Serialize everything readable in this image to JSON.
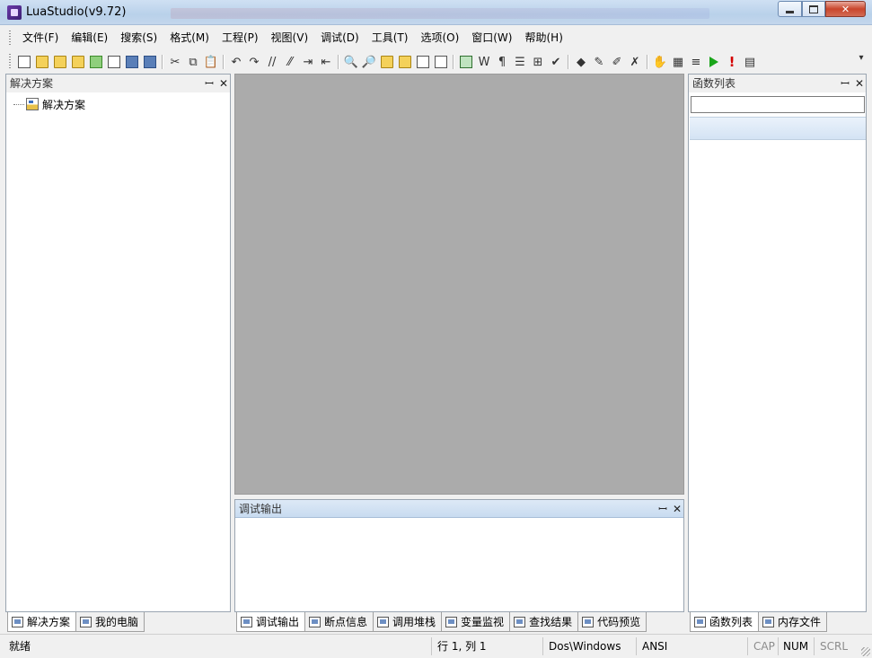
{
  "window": {
    "title": "LuaStudio(v9.72)",
    "controls": {
      "minimize": "minimize",
      "maximize": "maximize",
      "close": "✕"
    }
  },
  "menu": [
    "文件(F)",
    "编辑(E)",
    "搜索(S)",
    "格式(M)",
    "工程(P)",
    "视图(V)",
    "调试(D)",
    "工具(T)",
    "选项(O)",
    "窗口(W)",
    "帮助(H)"
  ],
  "toolbar": {
    "icons": [
      "new-file-icon",
      "new-project-icon",
      "open-folder-icon",
      "open-project-icon",
      "properties-icon",
      "tree-icon",
      "save-icon",
      "save-all-icon",
      "cut-icon",
      "copy-icon",
      "paste-icon",
      "undo-icon",
      "redo-icon",
      "comment-icon",
      "uncomment-icon",
      "indent-icon",
      "outdent-icon",
      "find-icon",
      "find-next-icon",
      "find-in-files-icon",
      "replace-icon",
      "bookmark-prev-icon",
      "bookmark-next-icon",
      "fullscreen-icon",
      "word-wrap-icon",
      "pilcrow-icon",
      "format-icon",
      "toggle-icon",
      "check-icon",
      "breakpoint-icon",
      "breakpoint-add-icon",
      "breakpoint-remove-icon",
      "breakpoint-clear-icon",
      "hand-icon",
      "calendar-icon",
      "list-icon",
      "run-icon",
      "stop-icon",
      "panel-icon"
    ],
    "overflow": "▾"
  },
  "left_panel": {
    "title": "解决方案",
    "pin": "ꟷ",
    "close": "✕",
    "tree_root": "解决方案",
    "tabs": [
      "解决方案",
      "我的电脑"
    ]
  },
  "output_panel": {
    "title": "调试输出",
    "tabs": [
      "调试输出",
      "断点信息",
      "调用堆栈",
      "变量监视",
      "查找结果",
      "代码预览"
    ]
  },
  "right_panel": {
    "title": "函数列表",
    "search_value": "",
    "tabs": [
      "函数列表",
      "内存文件"
    ]
  },
  "status": {
    "ready": "就绪",
    "position": "行 1, 列 1",
    "line_ending": "Dos\\Windows",
    "encoding": "ANSI",
    "cap": "CAP",
    "num": "NUM",
    "scrl": "SCRL"
  },
  "colors": {
    "editor_background": "#ababab",
    "play": "#1aa51a",
    "stop": "#d40000"
  }
}
